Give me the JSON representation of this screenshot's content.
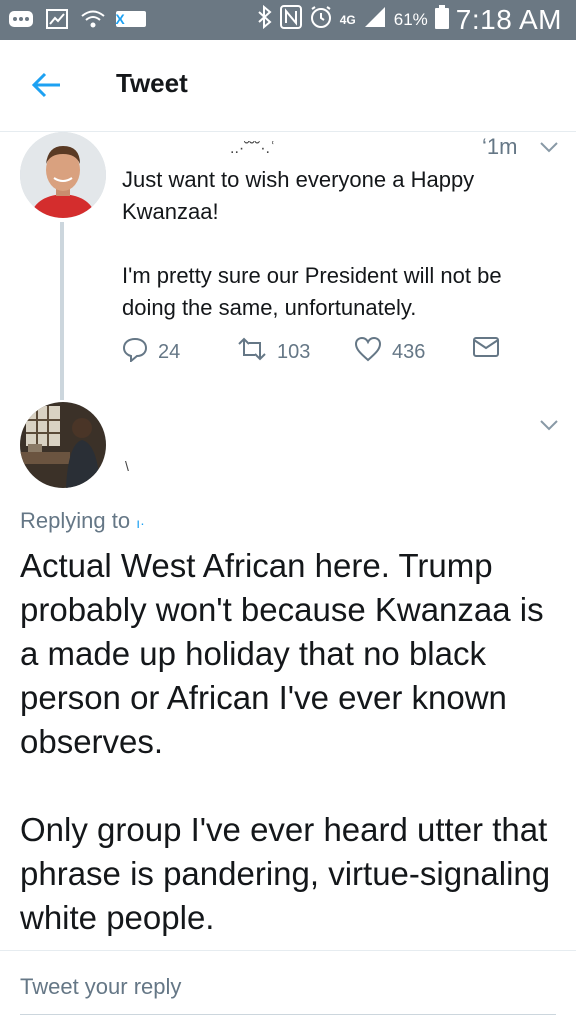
{
  "status_bar": {
    "notification_icons": [
      "more-icon",
      "screenshot-icon",
      "wifi-icon",
      "xposed-icon"
    ],
    "xposed_label": "X",
    "network": "4G",
    "battery_percent": "61%",
    "time": "7:18 AM"
  },
  "app_bar": {
    "title": "Tweet"
  },
  "thread_tweet": {
    "name_fragment": "..·˘˘˘·.ʿ",
    "timestamp": "‘1m",
    "text": "Just want to wish everyone a Happy Kwanzaa!\n\nI'm pretty sure our President will not be doing the same, unfortunately.",
    "replies": "24",
    "retweets": "103",
    "likes": "436"
  },
  "reply_tweet": {
    "name_fragment": "\\",
    "replying_prefix": "Replying to",
    "replying_handle": "ı·",
    "text": "Actual West African here.  Trump probably won't because Kwanzaa is a made up holiday that no black person or African I've ever known observes.\n\nOnly group I've ever heard utter that phrase is pandering, virtue-signaling white people."
  },
  "compose": {
    "placeholder": "Tweet your reply"
  },
  "colors": {
    "accent": "#1da1f2",
    "secondary_text": "#657786",
    "status_bar": "#6b7883"
  }
}
